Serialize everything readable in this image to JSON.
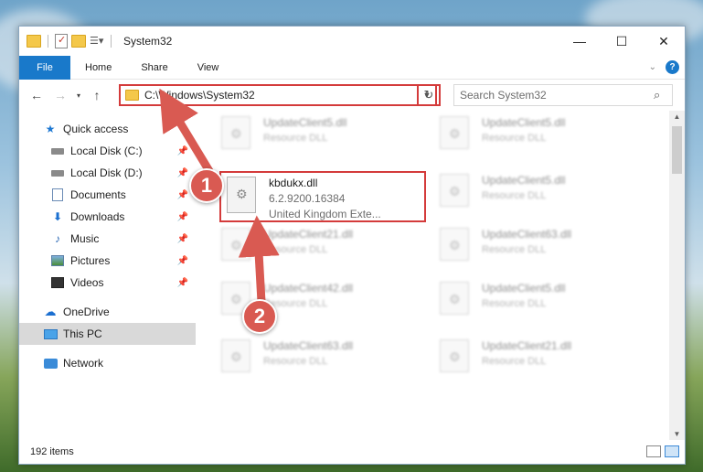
{
  "window": {
    "title": "System32",
    "controls": {
      "minimize": "—",
      "maximize": "☐",
      "close": "✕"
    }
  },
  "ribbon": {
    "tabs": [
      "File",
      "Home",
      "Share",
      "View"
    ],
    "help": "?"
  },
  "nav": {
    "address": "C:\\Windows\\System32",
    "search_placeholder": "Search System32"
  },
  "sidebar": {
    "quick_access": "Quick access",
    "items": [
      {
        "label": "Local Disk (C:)",
        "icon": "disk-icon",
        "pinned": true
      },
      {
        "label": "Local Disk (D:)",
        "icon": "disk-icon",
        "pinned": true
      },
      {
        "label": "Documents",
        "icon": "documents-icon",
        "pinned": true
      },
      {
        "label": "Downloads",
        "icon": "downloads-icon",
        "pinned": true
      },
      {
        "label": "Music",
        "icon": "music-icon",
        "pinned": true
      },
      {
        "label": "Pictures",
        "icon": "pictures-icon",
        "pinned": true
      },
      {
        "label": "Videos",
        "icon": "videos-icon",
        "pinned": true
      }
    ],
    "onedrive": "OneDrive",
    "this_pc": "This PC",
    "network": "Network"
  },
  "files": {
    "featured": {
      "name": "kbdukx.dll",
      "version": "6.2.9200.16384",
      "description": "United Kingdom Exte..."
    },
    "blurred": [
      {
        "name": "UpdateClient5.dll",
        "type": "Resource DLL"
      },
      {
        "name": "UpdateClient5.dll",
        "type": "Resource DLL"
      },
      {
        "name": "UpdateClient5.dll",
        "type": "Resource DLL"
      },
      {
        "name": "UpdateClient21.dll",
        "type": "Resource DLL"
      },
      {
        "name": "UpdateClient63.dll",
        "type": "Resource DLL"
      },
      {
        "name": "UpdateClient42.dll",
        "type": "Resource DLL"
      },
      {
        "name": "UpdateClient5.dll",
        "type": "Resource DLL"
      },
      {
        "name": "UpdateClient63.dll",
        "type": "Resource DLL"
      },
      {
        "name": "UpdateClient21.dll",
        "type": "Resource DLL"
      }
    ]
  },
  "status": {
    "item_count": "192 items"
  },
  "annotations": {
    "step1": "1",
    "step2": "2",
    "accent_color": "#d43b3b"
  }
}
